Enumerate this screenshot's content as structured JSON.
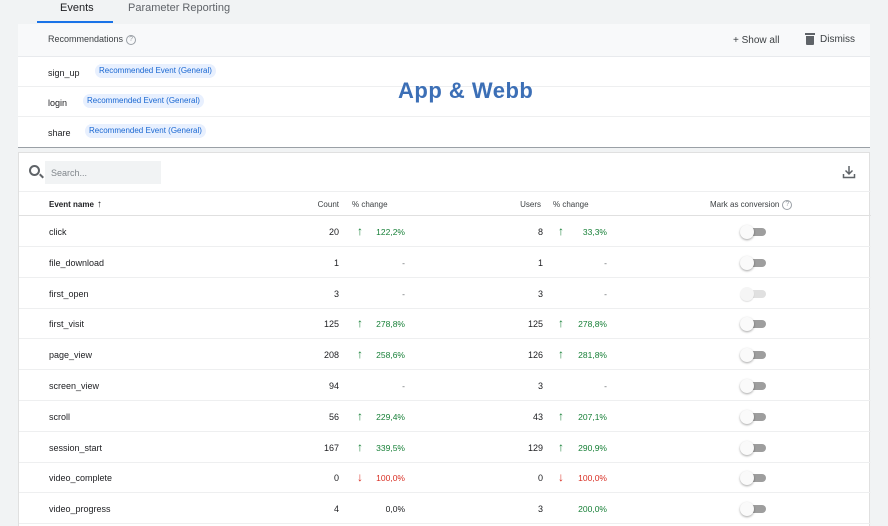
{
  "tabs": [
    {
      "label": "Events",
      "active": true
    },
    {
      "label": "Parameter Reporting",
      "active": false
    }
  ],
  "recommendations": {
    "title": "Recommendations",
    "help_glyph": "?",
    "show_all_label": "+ Show all",
    "dismiss_label": "Dismiss",
    "items": [
      {
        "name": "sign_up",
        "chip": "Recommended Event (General)"
      },
      {
        "name": "login",
        "chip": "Recommended Event (General)"
      },
      {
        "name": "share",
        "chip": "Recommended Event (General)"
      }
    ]
  },
  "watermark": "App & Webb",
  "search": {
    "placeholder": "Search..."
  },
  "table": {
    "headers": {
      "event_name": "Event name",
      "sort_arrow": "↑",
      "count": "Count",
      "count_change": "% change",
      "users": "Users",
      "users_change": "% change",
      "mark_conversion": "Mark as conversion",
      "help_glyph": "?"
    },
    "rows": [
      {
        "name": "click",
        "count": "20",
        "count_change": "122,2%",
        "count_dir": "up",
        "users": "8",
        "users_change": "33,3%",
        "users_dir": "up",
        "toggle": "off"
      },
      {
        "name": "file_download",
        "count": "1",
        "count_change": "-",
        "count_dir": "none",
        "users": "1",
        "users_change": "-",
        "users_dir": "none",
        "toggle": "off"
      },
      {
        "name": "first_open",
        "count": "3",
        "count_change": "-",
        "count_dir": "none",
        "users": "3",
        "users_change": "-",
        "users_dir": "none",
        "toggle": "disabled"
      },
      {
        "name": "first_visit",
        "count": "125",
        "count_change": "278,8%",
        "count_dir": "up",
        "users": "125",
        "users_change": "278,8%",
        "users_dir": "up",
        "toggle": "off"
      },
      {
        "name": "page_view",
        "count": "208",
        "count_change": "258,6%",
        "count_dir": "up",
        "users": "126",
        "users_change": "281,8%",
        "users_dir": "up",
        "toggle": "off"
      },
      {
        "name": "screen_view",
        "count": "94",
        "count_change": "-",
        "count_dir": "none",
        "users": "3",
        "users_change": "-",
        "users_dir": "none",
        "toggle": "off"
      },
      {
        "name": "scroll",
        "count": "56",
        "count_change": "229,4%",
        "count_dir": "up",
        "users": "43",
        "users_change": "207,1%",
        "users_dir": "up",
        "toggle": "off"
      },
      {
        "name": "session_start",
        "count": "167",
        "count_change": "339,5%",
        "count_dir": "up",
        "users": "129",
        "users_change": "290,9%",
        "users_dir": "up",
        "toggle": "off"
      },
      {
        "name": "video_complete",
        "count": "0",
        "count_change": "100,0%",
        "count_dir": "down",
        "users": "0",
        "users_change": "100,0%",
        "users_dir": "down",
        "toggle": "off"
      },
      {
        "name": "video_progress",
        "count": "4",
        "count_change": "0,0%",
        "count_dir": "flat",
        "users": "3",
        "users_change": "200,0%",
        "users_dir": "upnoarrow",
        "toggle": "off"
      }
    ]
  },
  "colors": {
    "accent": "#1a73e8",
    "positive": "#188038",
    "negative": "#d93025",
    "chip_bg": "#e8f0fe",
    "chip_text": "#1967d2"
  },
  "icons": [
    "search-icon",
    "download-icon",
    "trash-icon",
    "help-icon",
    "arrow-up-icon",
    "arrow-down-icon",
    "sort-ascending-icon"
  ]
}
